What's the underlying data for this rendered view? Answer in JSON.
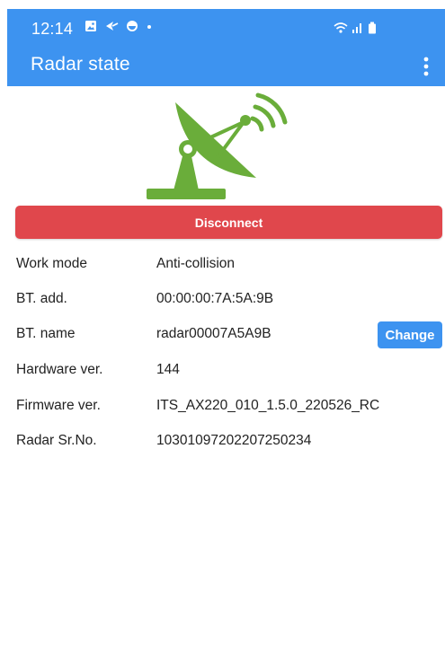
{
  "status_bar": {
    "time": "12:14",
    "left_icons": [
      "image-icon",
      "shortcut-icon",
      "app-icon",
      "dot-icon"
    ],
    "right_icons": [
      "wifi-icon",
      "signal-icon",
      "battery-icon"
    ]
  },
  "app_bar": {
    "title": "Radar state",
    "menu_icon": "more-vert-icon"
  },
  "radar_icon": "radar-dish-icon",
  "disconnect_button": {
    "label": "Disconnect",
    "color": "#e0474c"
  },
  "info": {
    "rows": [
      {
        "label": "Work mode",
        "value": "Anti-collision"
      },
      {
        "label": "BT. add.",
        "value": "00:00:00:7A:5A:9B"
      },
      {
        "label": "BT. name",
        "value": "radar00007A5A9B"
      },
      {
        "label": "Hardware ver.",
        "value": "144"
      },
      {
        "label": "Firmware ver.",
        "value": "ITS_AX220_010_1.5.0_220526_RC"
      },
      {
        "label": "Radar Sr.No.",
        "value": "10301097202207250234"
      }
    ],
    "change_button_label": "Change"
  },
  "colors": {
    "primary": "#3d93f0",
    "radar_green": "#6aad3a",
    "danger": "#e0474c"
  }
}
